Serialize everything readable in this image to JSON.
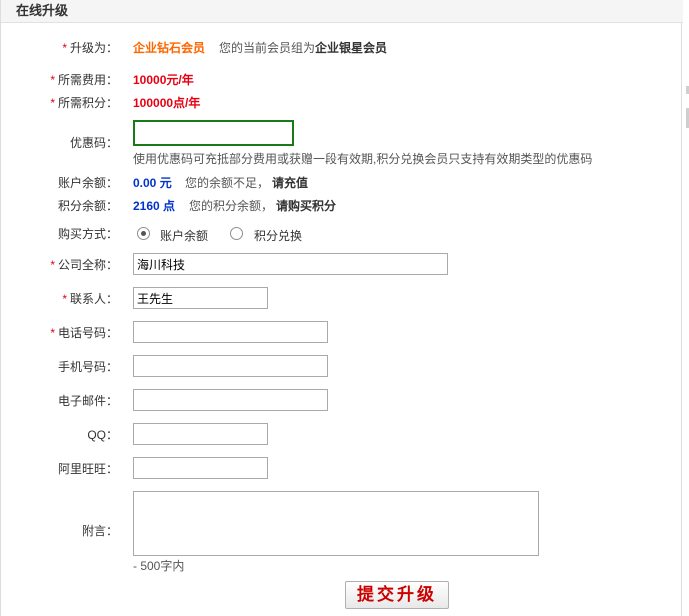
{
  "header": {
    "title": "在线升级"
  },
  "form": {
    "upgrade": {
      "label": "升级为：",
      "value": "企业钻石会员",
      "note_prefix": "您的当前会员组为",
      "current_group": "企业银星会员"
    },
    "fee": {
      "label": "所需费用：",
      "value": "10000元/年"
    },
    "points": {
      "label": "所需积分：",
      "value": "100000点/年"
    },
    "coupon": {
      "label": "优惠码：",
      "value": "",
      "hint": "使用优惠码可充抵部分费用或获赠一段有效期,积分兑换会员只支持有效期类型的优惠码"
    },
    "balance": {
      "label": "账户余额：",
      "value": "0.00 元",
      "note": "您的余额不足，",
      "action": "请充值"
    },
    "point_balance": {
      "label": "积分余额：",
      "value": "2160 点",
      "note": "您的积分余额，",
      "action": "请购买积分"
    },
    "payment": {
      "label": "购买方式：",
      "options": [
        "账户余额",
        "积分兑换"
      ],
      "selected": "账户余额"
    },
    "company": {
      "label": "公司全称：",
      "value": "海川科技"
    },
    "contact": {
      "label": "联系人：",
      "value": "王先生"
    },
    "phone": {
      "label": "电话号码：",
      "value": ""
    },
    "mobile": {
      "label": "手机号码：",
      "value": ""
    },
    "email": {
      "label": "电子邮件：",
      "value": ""
    },
    "qq": {
      "label": "QQ：",
      "value": ""
    },
    "aliwangwang": {
      "label": "阿里旺旺：",
      "value": ""
    },
    "remark": {
      "label": "附言：",
      "value": "",
      "limit_note": "- 500字内"
    },
    "submit_label": "提交升级"
  }
}
